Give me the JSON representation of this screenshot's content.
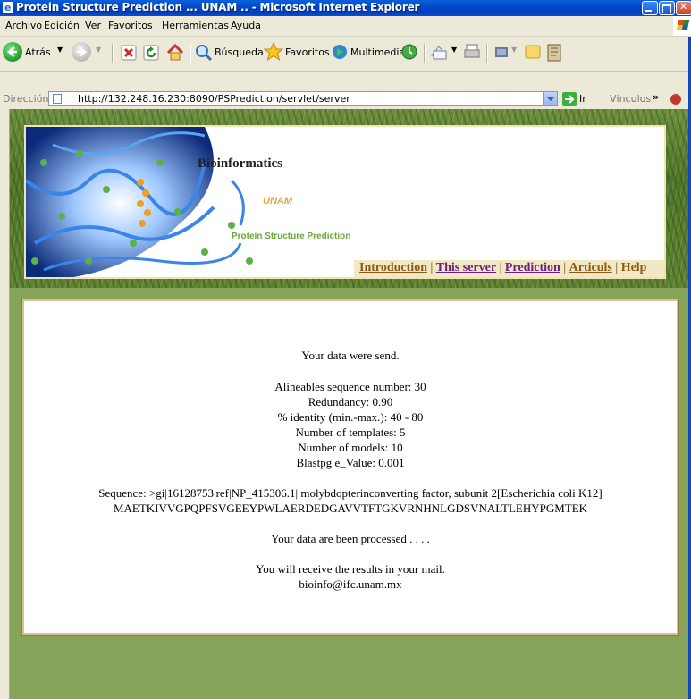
{
  "window": {
    "title": "Protein Structure Prediction ... UNAM .. - Microsoft Internet Explorer"
  },
  "menu": [
    "Archivo",
    "Edición",
    "Ver",
    "Favoritos",
    "Herramientas",
    "Ayuda"
  ],
  "toolbar": {
    "back_label": "Atrás",
    "search_label": "Búsqueda",
    "favorites_label": "Favoritos",
    "media_label": "Multimedia"
  },
  "address": {
    "label": "Dirección",
    "url": "http://132.248.16.230:8090/PSPrediction/servlet/server",
    "go_label": "Ir",
    "links_label": "Vínculos"
  },
  "banner": {
    "title": "Bioinformatics",
    "org": "UNAM",
    "subtitle": "Protein Structure Prediction",
    "nav": {
      "introduction": "Introduction",
      "this_server": "This server",
      "prediction": "Prediction",
      "articuls": "Articuls",
      "help": "Help"
    }
  },
  "content": {
    "lines": [
      "Your data were send.",
      "Alineables sequence number: 30",
      "Redundancy: 0.90",
      "% identity (min.-max.): 40 - 80",
      "Number of templates: 5",
      "Number of models: 10",
      "Blastpg e_Value: 0.001",
      "Sequence: >gi|16128753|ref|NP_415306.1| molybdopterinconverting factor, subunit 2[Escherichia coli K12]",
      "MAETKIVVGPQPFSVGEEYPWLAERDEDGAVVTFTGKVRNHNLGDSVNALTLEHYPGMTEK",
      "Your data are been processed . . . .",
      "You will receive the results in your mail.",
      "bioinfo@ifc.unam.mx"
    ]
  }
}
